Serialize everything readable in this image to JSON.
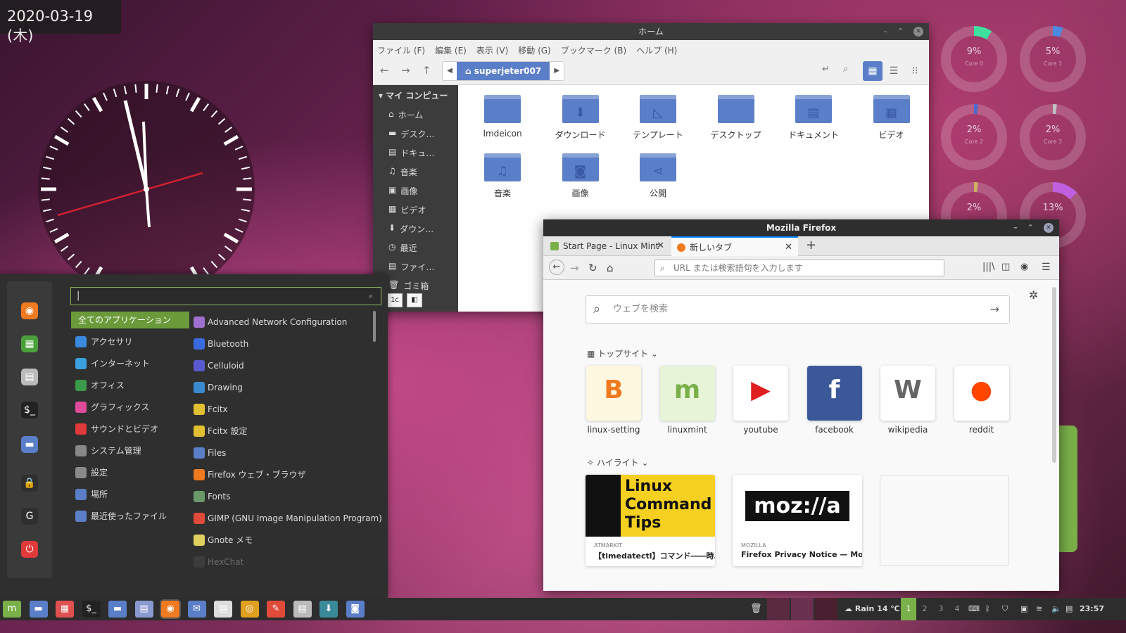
{
  "date": "2020-03-19 (木)",
  "cpu": [
    {
      "pct": "9%",
      "label": "Core 0",
      "value": 0.09,
      "color": "#3ee0a0"
    },
    {
      "pct": "5%",
      "label": "Core 1",
      "value": 0.05,
      "color": "#4a8ae0"
    },
    {
      "pct": "2%",
      "label": "Core 2",
      "value": 0.02,
      "color": "#4a6ad0"
    },
    {
      "pct": "2%",
      "label": "Core 3",
      "value": 0.02,
      "color": "#c0c0c0"
    },
    {
      "pct": "2%",
      "label": "",
      "value": 0.02,
      "color": "#d0b060"
    },
    {
      "pct": "13%",
      "label": "",
      "value": 0.13,
      "color": "#c060e0"
    }
  ],
  "fm": {
    "title": "ホーム",
    "menus": [
      "ファイル (F)",
      "編集 (E)",
      "表示 (V)",
      "移動 (G)",
      "ブックマーク (B)",
      "ヘルプ (H)"
    ],
    "location": "superjeter007",
    "side_header": "マイ コンピュー",
    "side": [
      {
        "icon": "⌂",
        "label": "ホーム"
      },
      {
        "icon": "▬",
        "label": "デスク…"
      },
      {
        "icon": "▤",
        "label": "ドキュ…"
      },
      {
        "icon": "♫",
        "label": "音楽"
      },
      {
        "icon": "▣",
        "label": "画像"
      },
      {
        "icon": "▦",
        "label": "ビデオ"
      },
      {
        "icon": "⬇",
        "label": "ダウン…"
      },
      {
        "icon": "◷",
        "label": "最近"
      },
      {
        "icon": "▤",
        "label": "ファイ…"
      },
      {
        "icon": "🗑",
        "label": "ゴミ箱"
      }
    ],
    "folders": [
      {
        "name": "Imdeicon",
        "glyph": ""
      },
      {
        "name": "ダウンロード",
        "glyph": "⬇"
      },
      {
        "name": "テンプレート",
        "glyph": "◺"
      },
      {
        "name": "デスクトップ",
        "glyph": ""
      },
      {
        "name": "ドキュメント",
        "glyph": "▤"
      },
      {
        "name": "ビデオ",
        "glyph": "▦"
      },
      {
        "name": "音楽",
        "glyph": "♫"
      },
      {
        "name": "画像",
        "glyph": "◙"
      },
      {
        "name": "公開",
        "glyph": "⋖"
      }
    ],
    "status_btn": "1c"
  },
  "menu": {
    "search_value": "|",
    "categories": [
      "全てのアプリケーション",
      "アクセサリ",
      "インターネット",
      "オフィス",
      "グラフィックス",
      "サウンドとビデオ",
      "システム管理",
      "設定",
      "場所",
      "最近使ったファイル"
    ],
    "cat_colors": [
      "#6a9a3a",
      "#3a8ae0",
      "#3aa0e0",
      "#3a9a4a",
      "#e04a9a",
      "#e03a3a",
      "#888888",
      "#8a8a8a",
      "#5b7ec8",
      "#5b7ec8"
    ],
    "apps": [
      {
        "name": "Advanced Network Configuration",
        "color": "#a070d0"
      },
      {
        "name": "Bluetooth",
        "color": "#3a6ae0"
      },
      {
        "name": "Celluloid",
        "color": "#5a5ad0"
      },
      {
        "name": "Drawing",
        "color": "#3a8ad0"
      },
      {
        "name": "Fcitx",
        "color": "#e0c030"
      },
      {
        "name": "Fcitx 設定",
        "color": "#e0c030"
      },
      {
        "name": "Files",
        "color": "#5b7ec8"
      },
      {
        "name": "Firefox ウェブ・ブラウザ",
        "color": "#f07a20"
      },
      {
        "name": "Fonts",
        "color": "#6a9a6a"
      },
      {
        "name": "GIMP (GNU Image Manipulation Program)",
        "color": "#e04a3a"
      },
      {
        "name": "Gnote メモ",
        "color": "#e0d060"
      },
      {
        "name": "HexChat",
        "color": "#555555"
      }
    ],
    "fav": [
      {
        "icon": "firefox-icon",
        "glyph": "◉",
        "color": "#f07a20"
      },
      {
        "icon": "software-icon",
        "glyph": "▦",
        "color": "#4aa03a"
      },
      {
        "icon": "settings-icon",
        "glyph": "▤",
        "color": "#bbbbbb"
      },
      {
        "icon": "terminal-icon",
        "glyph": "$_",
        "color": "#222222"
      },
      {
        "icon": "folder-icon",
        "glyph": "▬",
        "color": "#5b7ec8"
      },
      {
        "icon": "lock-icon",
        "glyph": "🔒",
        "color": "#2f2f2f"
      },
      {
        "icon": "logout-icon",
        "glyph": "G",
        "color": "#2f2f2f"
      },
      {
        "icon": "power-icon",
        "glyph": "⏻",
        "color": "#e03a3a"
      }
    ]
  },
  "ff": {
    "title": "Mozilla Firefox",
    "tab1": "Start Page - Linux Mint",
    "tab2": "新しいタブ",
    "url_placeholder": "URL または検索語句を入力します",
    "web_search": "ウェブを検索",
    "top_sites": "トップサイト",
    "highlights": "ハイライト",
    "tiles": [
      {
        "name": "linux-setting",
        "color": "#fff8e0",
        "glyph": "B",
        "gcolor": "#f07a20"
      },
      {
        "name": "linuxmint",
        "color": "#e8f4d8",
        "glyph": "m",
        "gcolor": "#7ab04a"
      },
      {
        "name": "youtube",
        "color": "#ffffff",
        "glyph": "▶",
        "gcolor": "#e02020"
      },
      {
        "name": "facebook",
        "color": "#3b5998",
        "glyph": "f",
        "gcolor": "#ffffff"
      },
      {
        "name": "wikipedia",
        "color": "#ffffff",
        "glyph": "W",
        "gcolor": "#666666"
      },
      {
        "name": "reddit",
        "color": "#ffffff",
        "glyph": "●",
        "gcolor": "#ff4500"
      }
    ],
    "hl": [
      {
        "src": "ATMARKIT",
        "title": "【timedatectl】コマンド――時…",
        "img_text": "Linux Command Tips"
      },
      {
        "src": "MOZILLA",
        "title": "Firefox Privacy Notice — Mozilla",
        "img_text": "moz://a"
      }
    ]
  },
  "taskbar": {
    "workspaces": [
      "1",
      "2",
      "3",
      "4"
    ],
    "weather": "Rain 14 ℃",
    "time": "23:57"
  }
}
